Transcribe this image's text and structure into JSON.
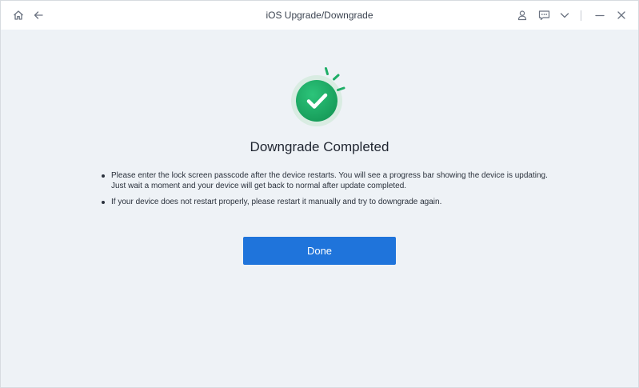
{
  "window": {
    "title": "iOS Upgrade/Downgrade"
  },
  "titlebar_icons": {
    "home": "home-icon",
    "back": "arrow-left-icon",
    "account": "user-icon",
    "feedback": "chat-icon",
    "menu": "chevron-down-icon",
    "minimize": "minimize-icon",
    "close": "close-icon"
  },
  "main": {
    "status_icon": "check-icon",
    "heading": "Downgrade Completed",
    "notes": [
      "Please enter the lock screen passcode after the device restarts. You will see a progress bar showing the device is updating. Just wait a moment and your device will get back to normal after update completed.",
      "If your device does not restart properly, please restart it manually and try to downgrade again."
    ],
    "done_label": "Done"
  },
  "colors": {
    "accent": "#1f74db",
    "success": "#1fae67",
    "background": "#eef2f6",
    "titlebar": "#ffffff"
  }
}
